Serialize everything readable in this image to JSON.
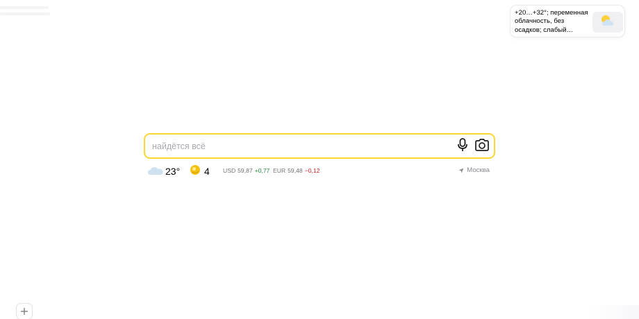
{
  "weather_card": {
    "text": "+20…+32°; переменная облачность, без осадков; слабый ветер…",
    "icon": "partly-cloudy-icon"
  },
  "search": {
    "placeholder": "найдётся всё",
    "value": "",
    "accent_color": "#fcd734",
    "voice_icon": "microphone-icon",
    "image_search_icon": "camera-icon"
  },
  "informers": {
    "weather": {
      "icon": "cloud-icon",
      "temp": "23°"
    },
    "traffic": {
      "icon": "traffic-level-icon",
      "score": "4",
      "color": "#f3c10f"
    },
    "rates": [
      {
        "name": "USD",
        "value": "59,87",
        "delta": "+0,77",
        "direction": "up"
      },
      {
        "name": "EUR",
        "value": "59,48",
        "delta": "−0,12",
        "direction": "down"
      }
    ],
    "location": {
      "icon": "location-arrow-icon",
      "label": "Москва"
    }
  },
  "add_button": {
    "icon": "plus-icon"
  }
}
